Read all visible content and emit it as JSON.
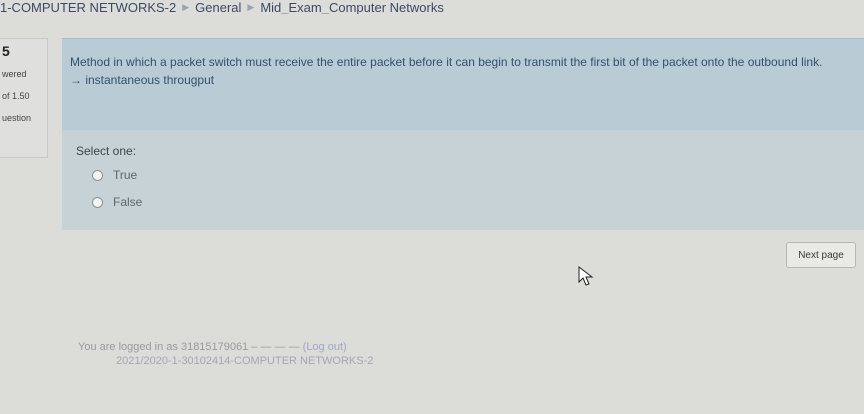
{
  "breadcrumb": {
    "course": "1-COMPUTER NETWORKS-2",
    "section": "General",
    "quiz": "Mid_Exam_Computer Networks"
  },
  "question_info": {
    "number": "5",
    "status": "wered",
    "mark": "of 1.50",
    "flag": "uestion"
  },
  "question": {
    "text": "Method in which a packet switch must receive the entire packet before it can begin to transmit the first bit of the packet onto the outbound link. → instantaneous througput",
    "select_label": "Select one:",
    "options": [
      "True",
      "False"
    ]
  },
  "navigation": {
    "next_label": "Next page"
  },
  "footer": {
    "logged_in_text": "You are logged in as 31815179061 – — — —",
    "logout_label": "(Log out)",
    "course_line": "2021/2020-1-30102414-COMPUTER NETWORKS-2"
  }
}
